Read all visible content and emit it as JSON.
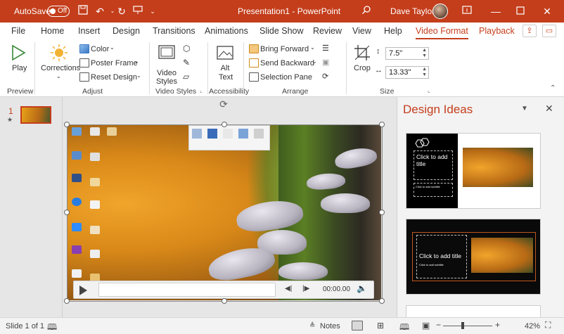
{
  "titlebar": {
    "autosave_label": "AutoSave",
    "autosave_state": "Off",
    "title": "Presentation1  -  PowerPoint",
    "user_name": "Dave Taylor"
  },
  "tabs": [
    {
      "label": "File"
    },
    {
      "label": "Home"
    },
    {
      "label": "Insert"
    },
    {
      "label": "Design"
    },
    {
      "label": "Transitions"
    },
    {
      "label": "Animations"
    },
    {
      "label": "Slide Show"
    },
    {
      "label": "Review"
    },
    {
      "label": "View"
    },
    {
      "label": "Help"
    },
    {
      "label": "Video Format"
    },
    {
      "label": "Playback"
    }
  ],
  "ribbon": {
    "preview": {
      "play_label": "Play",
      "group": "Preview"
    },
    "adjust": {
      "corrections_label": "Corrections",
      "color_label": "Color",
      "poster_frame_label": "Poster Frame",
      "reset_design_label": "Reset Design",
      "group": "Adjust"
    },
    "video_styles": {
      "label": "Video Styles",
      "group": "Video Styles"
    },
    "accessibility": {
      "alt_text_label": "Alt Text",
      "group": "Accessibility"
    },
    "arrange": {
      "bring_forward_label": "Bring Forward",
      "send_backward_label": "Send Backward",
      "selection_pane_label": "Selection Pane",
      "group": "Arrange"
    },
    "size": {
      "crop_label": "Crop",
      "height_value": "7.5\"",
      "width_value": "13.33\"",
      "group": "Size"
    }
  },
  "thumbnails": {
    "slide_number": "1",
    "star": "★"
  },
  "player": {
    "time": "00:00.00"
  },
  "design_ideas": {
    "title": "Design Ideas",
    "idea1_title": "Click to add title",
    "idea1_subtitle": "Click to add subtitle",
    "idea2_title": "Click to add title",
    "idea2_subtitle": "Click to add subtitle"
  },
  "status": {
    "slide_info": "Slide 1 of 1",
    "notes_label": "Notes",
    "zoom": "42%"
  },
  "colors": {
    "accent": "#c43e1c"
  }
}
